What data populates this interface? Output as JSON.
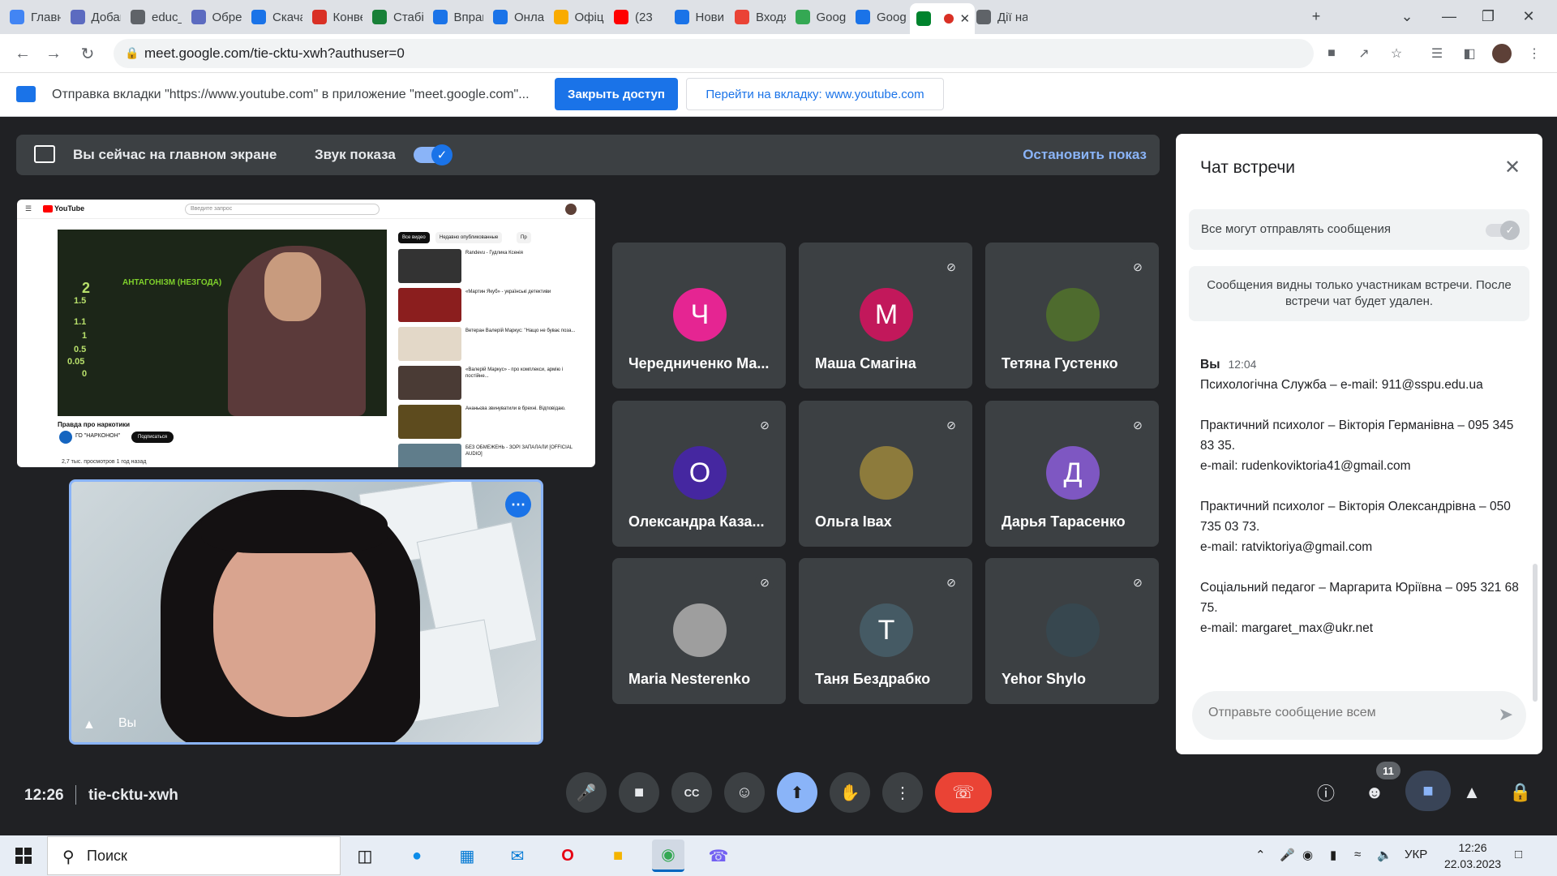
{
  "browser": {
    "tabs": [
      {
        "label": "Главн",
        "color": "#4285f4"
      },
      {
        "label": "Добав",
        "color": "#5c6bc0"
      },
      {
        "label": "educ_",
        "color": "#5f6368"
      },
      {
        "label": "Обрез",
        "color": "#5c6bc0"
      },
      {
        "label": "Скача",
        "color": "#1a73e8"
      },
      {
        "label": "Конве",
        "color": "#d93025"
      },
      {
        "label": "Стабі",
        "color": "#188038"
      },
      {
        "label": "Вправ",
        "color": "#1a73e8"
      },
      {
        "label": "Онлай",
        "color": "#1a73e8"
      },
      {
        "label": "Офіці",
        "color": "#f9ab00"
      },
      {
        "label": "(23",
        "color": "#ff0000"
      },
      {
        "label": "Новин",
        "color": "#1a73e8"
      },
      {
        "label": "Входя",
        "color": "#ea4335"
      },
      {
        "label": "Googl",
        "color": "#34a853"
      },
      {
        "label": "Googl",
        "color": "#1a73e8"
      },
      {
        "label": "",
        "color": "#00832d"
      },
      {
        "label": "Дії на",
        "color": "#5f6368"
      }
    ],
    "url": "meet.google.com/tie-cktu-xwh?authuser=0"
  },
  "infobar": {
    "text": "Отправка вкладки \"https://www.youtube.com\" в приложение \"meet.google.com\"...",
    "stop_access": "Закрыть доступ",
    "go_to_tab": "Перейти на вкладку: www.youtube.com"
  },
  "present_banner": {
    "main_screen": "Вы сейчас на главном экране",
    "audio": "Звук показа",
    "stop": "Остановить показ"
  },
  "shared": {
    "logo": "YouTube",
    "search_placeholder": "Введите запрос",
    "chips": [
      "Все видео",
      "Недавно опубликованные",
      "Пр"
    ],
    "video_label": "АНТАГОНІЗМ (НЕЗГОДА)",
    "numbers": [
      "2",
      "1.5",
      "1.1",
      "1",
      "0.5",
      "0.05",
      "0"
    ],
    "title": "Правда про наркотики",
    "channel": "ГО \"НАРКОНОН\"",
    "subscribe": "Подписаться",
    "meta": "2,7 тыс. просмотров  1 год назад",
    "recs": [
      "Randevu - Гудлика Ксенія",
      "«Мартин Якуб» - українські детективи",
      "Ветеран Валерій Маркус: \"Нащо не буває поза...",
      "«Валерій Маркус» - про комплекси, армію і постійне...",
      "Ананьєва звинуватили в брехні. Відповідаю.",
      "БЕЗ ОБМЕЖЕНЬ - ЗОРІ ЗАПАЛАЛИ [OFFICIAL AUDIO]"
    ]
  },
  "self": {
    "name": "Вы"
  },
  "participants": [
    {
      "name": "Чередниченко Ма...",
      "initial": "Ч",
      "color": "#e52592",
      "muted": false
    },
    {
      "name": "Маша Смагіна",
      "initial": "М",
      "color": "#c2185b",
      "muted": true
    },
    {
      "name": "Тетяна Густенко",
      "initial": "",
      "color": "#4e6b2e",
      "muted": true
    },
    {
      "name": "Олександра Каза...",
      "initial": "О",
      "color": "#4527a0",
      "muted": true
    },
    {
      "name": "Ольга Івах",
      "initial": "",
      "color": "#8d7b3c",
      "muted": true
    },
    {
      "name": "Дарья Тарасенко",
      "initial": "Д",
      "color": "#7e57c2",
      "muted": true
    },
    {
      "name": "Maria Nesterenko",
      "initial": "",
      "color": "#9e9e9e",
      "muted": true
    },
    {
      "name": "Таня Бездрабко",
      "initial": "Т",
      "color": "#455a64",
      "muted": true
    },
    {
      "name": "Yehor Shylo",
      "initial": "",
      "color": "#37474f",
      "muted": true
    }
  ],
  "chat": {
    "title": "Чат встречи",
    "permission": "Все могут отправлять сообщения",
    "note": "Сообщения видны только участникам встречи. После встречи чат будет удален.",
    "sender": "Вы",
    "time": "12:04",
    "messages": [
      "Психологічна Служба – e-mail: 911@sspu.edu.ua",
      "Практичний психолог – Вікторія Германівна – 095 345 83 35.\ne-mail: rudenkoviktoria41@gmail.com",
      "Практичний психолог – Вікторія Олександрівна – 050 735 03 73.\ne-mail: ratviktoriya@gmail.com",
      "Соціальний педагог – Маргарита Юріївна – 095 321 68 75.\ne-mail: margaret_max@ukr.net"
    ],
    "input_placeholder": "Отправьте сообщение всем"
  },
  "controls": {
    "time": "12:26",
    "meeting_code": "tie-cktu-xwh",
    "people_count": "11"
  },
  "taskbar": {
    "search": "Поиск",
    "lang": "УКР",
    "time": "12:26",
    "date": "22.03.2023"
  },
  "colors": {
    "accent": "#1a73e8",
    "meet_bg": "#202124",
    "tile_bg": "#3c4043",
    "hangup": "#ea4335"
  }
}
